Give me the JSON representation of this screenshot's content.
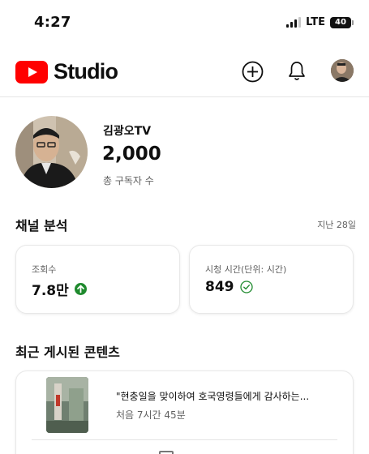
{
  "status_bar": {
    "time": "4:27",
    "network": "LTE",
    "battery": "40"
  },
  "header": {
    "logo_text": "Studio",
    "icons": [
      "create-icon",
      "bell-icon",
      "avatar"
    ]
  },
  "channel": {
    "name": "김광오TV",
    "subscribers": "2,000",
    "subscribers_label": "총 구독자 수"
  },
  "analytics": {
    "title": "채널 분석",
    "period": "지난 28일",
    "cards": [
      {
        "label": "조회수",
        "value": "7.8만",
        "icon": "trend-up-icon"
      },
      {
        "label": "시청 시간(단위: 시간)",
        "value": "849",
        "icon": "check-circle-icon"
      }
    ]
  },
  "recent": {
    "title": "최근 게시된 콘텐츠",
    "videos": [
      {
        "title": "\"현충일을 맞이하여 호국영령들에게 감사하는...",
        "meta": "처음 7시간 45분"
      }
    ]
  },
  "colors": {
    "brand_red": "#ff0000",
    "positive_green": "#1f8a2e"
  }
}
